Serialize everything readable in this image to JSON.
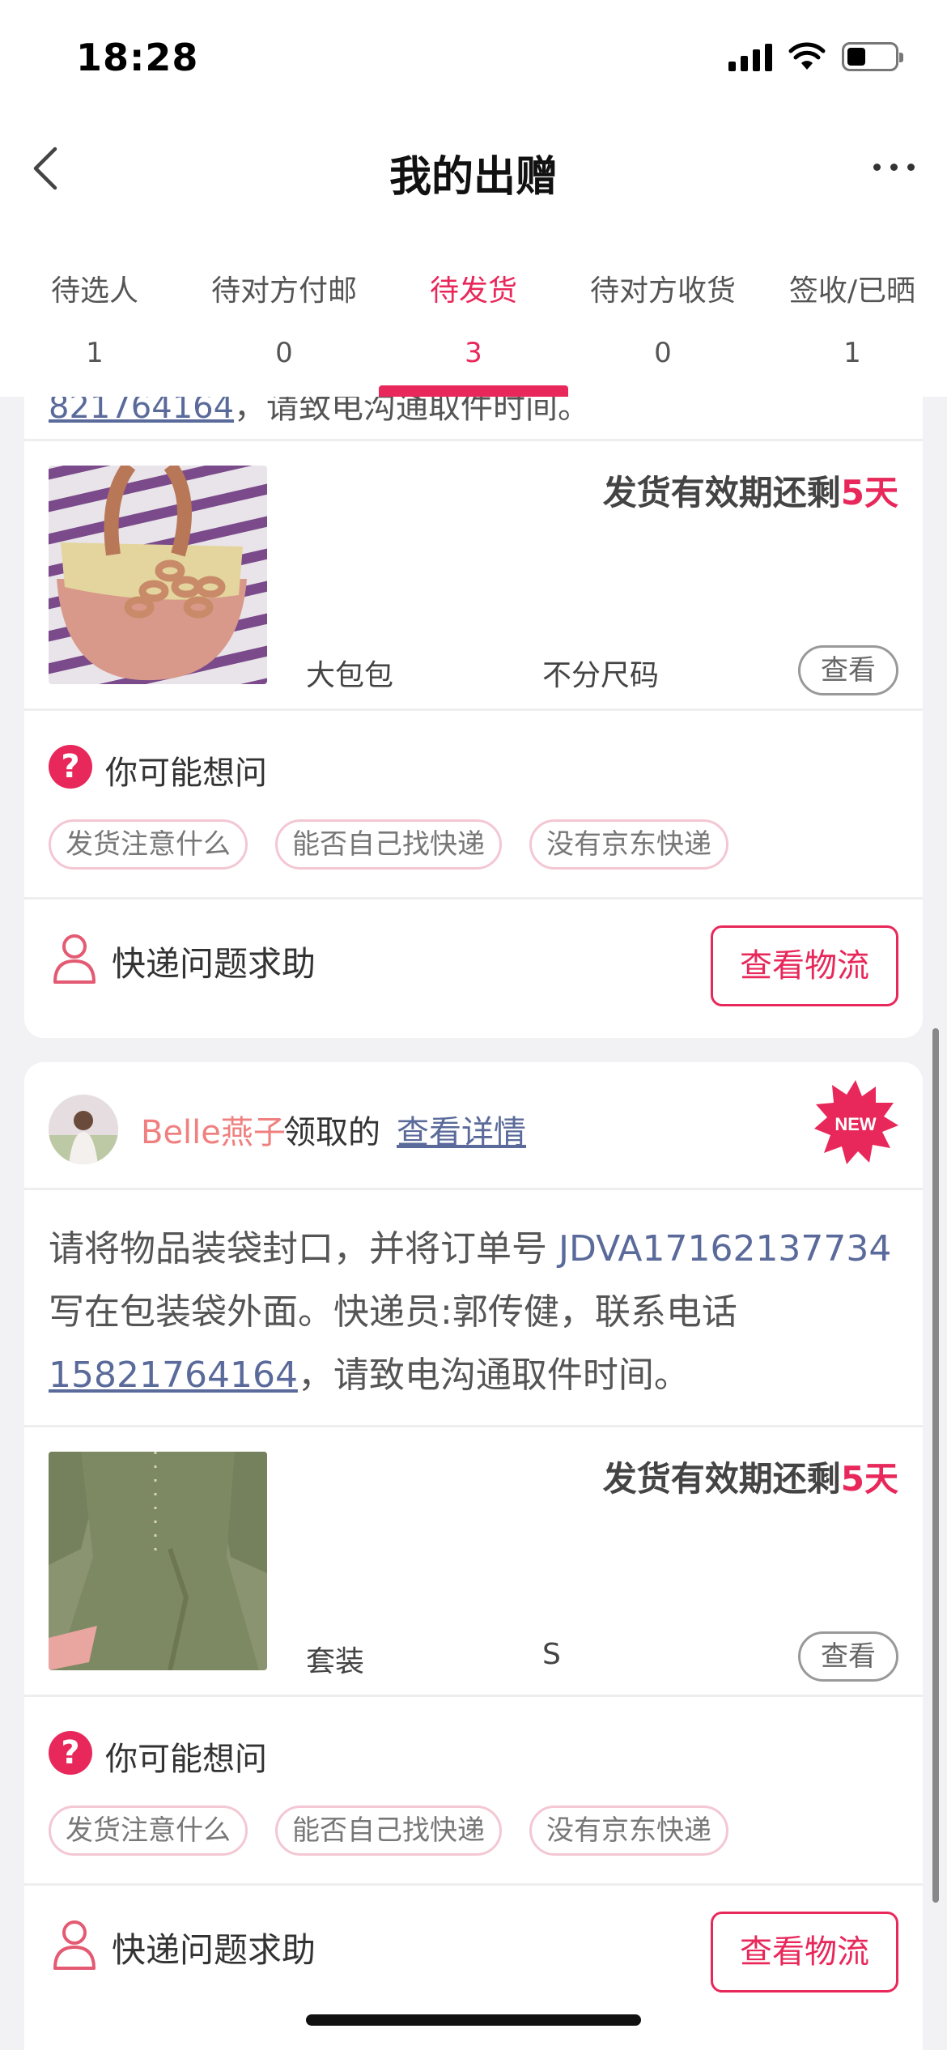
{
  "status_bar": {
    "time": "18:28"
  },
  "nav": {
    "title": "我的出赠"
  },
  "tabs": [
    {
      "label": "待选人",
      "count": "1",
      "active": false
    },
    {
      "label": "待对方付邮",
      "count": "0",
      "active": false
    },
    {
      "label": "待发货",
      "count": "3",
      "active": true
    },
    {
      "label": "待对方收货",
      "count": "0",
      "active": false
    },
    {
      "label": "签收/已晒",
      "count": "1",
      "active": false
    }
  ],
  "card1": {
    "peek": {
      "phone": "821764164",
      "after": "，请致电沟通取件时间。"
    },
    "deadline": {
      "prefix": "发货有效期还剩",
      "days": "5天"
    },
    "product": {
      "name": "大包包",
      "size": "不分尺码",
      "view_label": "查看"
    },
    "faq": {
      "title": "你可能想问",
      "chips": [
        "发货注意什么",
        "能否自己找快递",
        "没有京东快递"
      ]
    },
    "help": {
      "text": "快递问题求助",
      "logistics_label": "查看物流"
    }
  },
  "card2": {
    "receiver": {
      "name": "Belle燕子",
      "action": "领取的",
      "link": "查看详情",
      "badge": "NEW"
    },
    "instructions": {
      "part1": "请将物品装袋封口，并将订单号 ",
      "order_no": "JDVA17162137734",
      "part2": " 写在包装袋外面。快递员:郭传健，联系电话",
      "phone": "15821764164",
      "part3": "，请致电沟通取件时间。"
    },
    "deadline": {
      "prefix": "发货有效期还剩",
      "days": "5天"
    },
    "product": {
      "name": "套装",
      "size": "S",
      "view_label": "查看"
    },
    "faq": {
      "title": "你可能想问",
      "chips": [
        "发货注意什么",
        "能否自己找快递",
        "没有京东快递"
      ]
    },
    "help": {
      "text": "快递问题求助",
      "logistics_label": "查看物流"
    }
  }
}
